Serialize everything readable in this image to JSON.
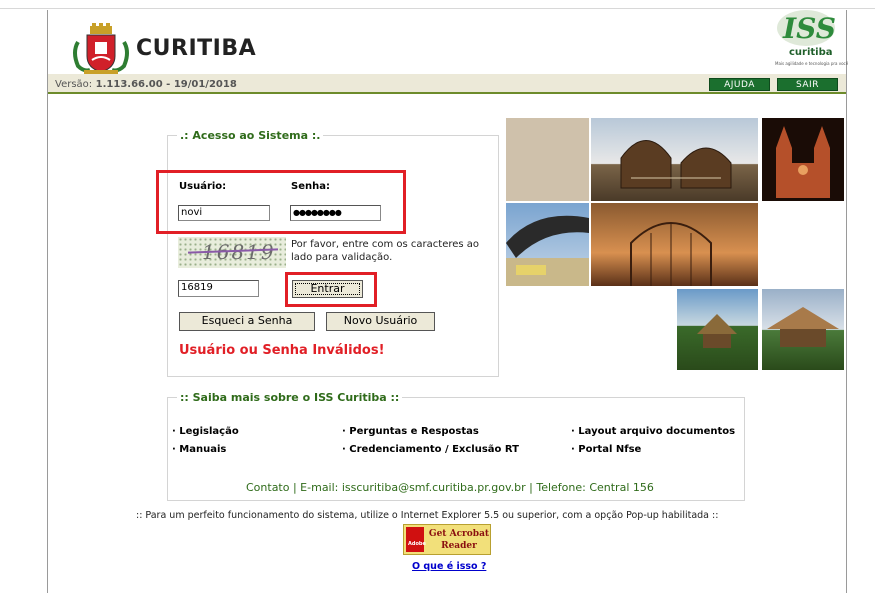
{
  "header": {
    "brand_name": "CURITIBA",
    "version_label": "Versão:",
    "version_value": "1.113.66.00 - 19/01/2018",
    "iss_logo": {
      "big": "ISS",
      "sub": "curitiba",
      "tagline": "Mais agilidade e tecnologia pra você"
    },
    "nav": {
      "help": "AJUDA",
      "exit": "SAIR"
    }
  },
  "login": {
    "legend": ".: Acesso ao Sistema :.",
    "user_label": "Usuário:",
    "password_label": "Senha:",
    "user_value": "novi",
    "password_value": "●●●●●●●●",
    "captcha_image_text": "16819",
    "captcha_instructions": "Por favor, entre com os caracteres ao lado para validação.",
    "captcha_value": "16819",
    "enter_button": "Entrar",
    "forgot_button": "Esqueci a Senha",
    "new_user_button": "Novo Usuário",
    "error_message": "Usuário ou Senha Inválidos!"
  },
  "info": {
    "legend": ":: Saiba mais sobre o ISS Curitiba ::",
    "links": [
      "· Legislação",
      "· Perguntas e Respostas",
      "· Layout arquivo documentos",
      "· Manuais",
      "· Credenciamento / Exclusão RT",
      "· Portal Nfse"
    ],
    "contact": "Contato | E-mail: isscuritiba@smf.curitiba.pr.gov.br | Telefone: Central 156"
  },
  "footer": {
    "note": ":: Para um perfeito funcionamento do sistema, utilize o Internet Explorer 5.5 ou superior, com a opção Pop-up habilitada ::",
    "acrobat_brand": "Adobe",
    "acrobat_text": "Get Acrobat Reader",
    "what_is_it": "O que é isso ?"
  },
  "colors": {
    "green": "#1b6f2e",
    "highlight_red": "#e11f26",
    "legend_green": "#2f6b1a"
  },
  "icons": [
    "curitiba-coat-of-arms-icon",
    "iss-logo-icon",
    "adobe-acrobat-icon"
  ]
}
